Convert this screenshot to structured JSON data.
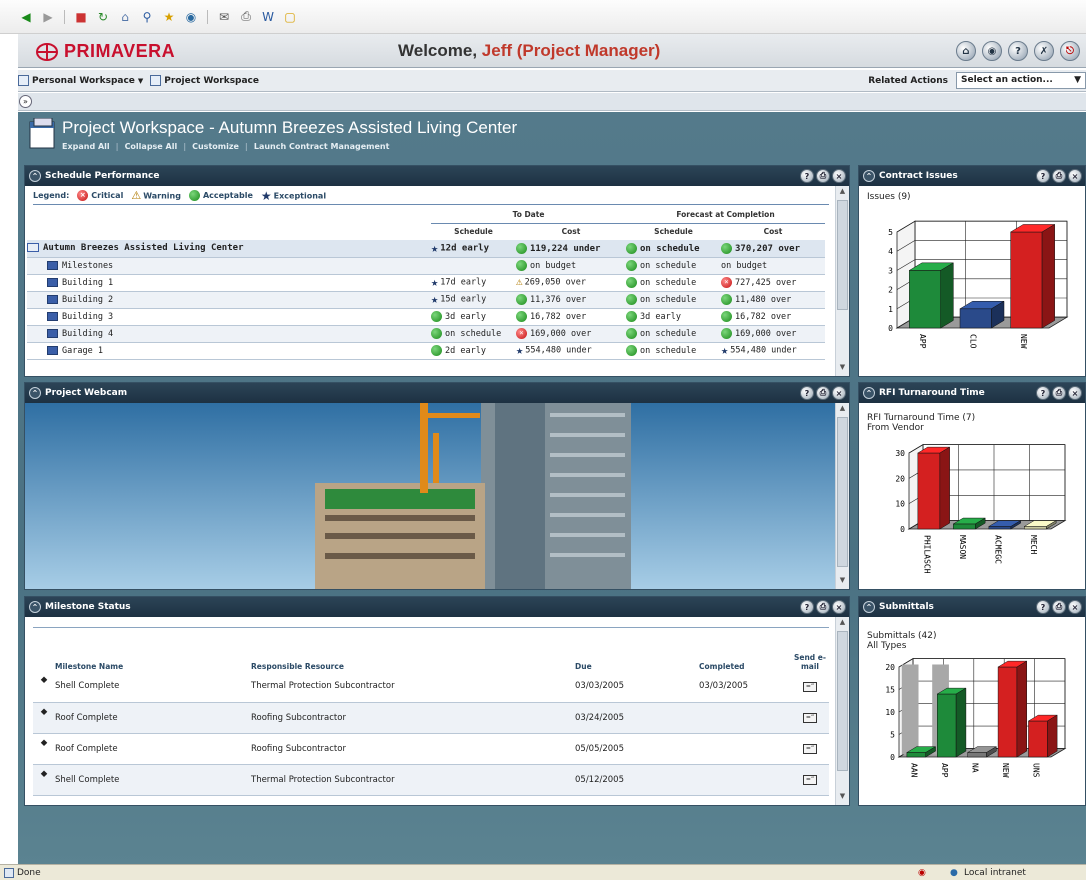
{
  "browser": {
    "status_left": "Done",
    "status_right": "Local intranet"
  },
  "header": {
    "logo": "PRIMAVERA",
    "welcome": "Welcome, ",
    "user": "Jeff (Project Manager)"
  },
  "nav": {
    "crumb1": "Personal Workspace",
    "crumb2": "Project Workspace",
    "related_actions": "Related Actions",
    "select_value": "Select an action..."
  },
  "workspace": {
    "title": "Project Workspace - Autumn Breezes Assisted Living Center",
    "links": [
      "Expand All",
      "Collapse All",
      "Customize",
      "Launch Contract Management"
    ]
  },
  "schedule": {
    "title": "Schedule Performance",
    "legend_label": "Legend:",
    "legend": [
      "Critical",
      "Warning",
      "Acceptable",
      "Exceptional"
    ],
    "group_to_date": "To Date",
    "group_forecast": "Forecast at Completion",
    "col_schedule": "Schedule",
    "col_cost": "Cost",
    "rows": [
      {
        "name": "Autumn Breezes Assisted Living Center",
        "s1": "12d early",
        "s1i": "star",
        "c1": "119,224 under",
        "c1i": "green",
        "s2": "on schedule",
        "s2i": "green",
        "c2": "370,207 over",
        "c2i": "green"
      },
      {
        "name": "Milestones",
        "s1": "",
        "s1i": "",
        "c1": "on budget",
        "c1i": "green",
        "s2": "on schedule",
        "s2i": "green",
        "c2": "on budget",
        "c2i": ""
      },
      {
        "name": "Building 1",
        "s1": "17d early",
        "s1i": "star",
        "c1": "269,050 over",
        "c1i": "warn",
        "s2": "on schedule",
        "s2i": "green",
        "c2": "727,425 over",
        "c2i": "red"
      },
      {
        "name": "Building 2",
        "s1": "15d early",
        "s1i": "star",
        "c1": "11,376 over",
        "c1i": "green",
        "s2": "on schedule",
        "s2i": "green",
        "c2": "11,480 over",
        "c2i": "green"
      },
      {
        "name": "Building 3",
        "s1": "3d early",
        "s1i": "green",
        "c1": "16,782 over",
        "c1i": "green",
        "s2": "3d early",
        "s2i": "green",
        "c2": "16,782 over",
        "c2i": "green"
      },
      {
        "name": "Building 4",
        "s1": "on schedule",
        "s1i": "green",
        "c1": "169,000 over",
        "c1i": "red",
        "s2": "on schedule",
        "s2i": "green",
        "c2": "169,000 over",
        "c2i": "green"
      },
      {
        "name": "Garage 1",
        "s1": "2d early",
        "s1i": "green",
        "c1": "554,480 under",
        "c1i": "star",
        "s2": "on schedule",
        "s2i": "green",
        "c2": "554,480 under",
        "c2i": "star"
      }
    ]
  },
  "webcam": {
    "title": "Project Webcam"
  },
  "milestone": {
    "title": "Milestone Status",
    "cols": [
      "Milestone Name",
      "Responsible Resource",
      "Due",
      "Completed",
      "Send e-mail"
    ],
    "rows": [
      {
        "name": "Shell Complete",
        "resource": "Thermal Protection Subcontractor",
        "due": "03/03/2005",
        "completed": "03/03/2005"
      },
      {
        "name": "Roof Complete",
        "resource": "Roofing Subcontractor",
        "due": "03/24/2005",
        "completed": ""
      },
      {
        "name": "Roof Complete",
        "resource": "Roofing Subcontractor",
        "due": "05/05/2005",
        "completed": ""
      },
      {
        "name": "Shell Complete",
        "resource": "Thermal Protection Subcontractor",
        "due": "05/12/2005",
        "completed": ""
      }
    ]
  },
  "panels": {
    "contract": "Contract Issues",
    "rfi": "RFI Turnaround Time",
    "submittals": "Submittals"
  },
  "chart_data": [
    {
      "type": "bar",
      "title": "Issues (9)",
      "categories": [
        "APP",
        "CLO",
        "NEW"
      ],
      "values": [
        3,
        1,
        5
      ],
      "ylim": [
        0,
        5
      ],
      "yticks": [
        0,
        1,
        2,
        3,
        4,
        5
      ],
      "colors": [
        "#1e8a3a",
        "#2a4a8a",
        "#d42020"
      ]
    },
    {
      "type": "bar",
      "title": "RFI Turnaround Time (7)",
      "subtitle": "From Vendor",
      "categories": [
        "PHILASCH",
        "MASON",
        "ACMEGC",
        "MECH"
      ],
      "values": [
        30,
        2,
        1,
        1
      ],
      "ylim": [
        0,
        30
      ],
      "yticks": [
        0,
        10,
        20,
        30
      ],
      "colors": [
        "#d42020",
        "#1e8a3a",
        "#2a4a8a",
        "#c8c8a0"
      ]
    },
    {
      "type": "bar",
      "title": "Submittals (42)",
      "subtitle": "All Types",
      "categories": [
        "AAN",
        "APP",
        "NA",
        "NEW",
        "UNS"
      ],
      "values": [
        1,
        14,
        1,
        20,
        8
      ],
      "background_series": [
        20,
        20,
        0,
        0,
        0
      ],
      "ylim": [
        0,
        20
      ],
      "yticks": [
        0,
        5,
        10,
        15,
        20
      ],
      "colors": [
        "#1e8a3a",
        "#1e8a3a",
        "#777777",
        "#d42020",
        "#d42020"
      ]
    }
  ]
}
